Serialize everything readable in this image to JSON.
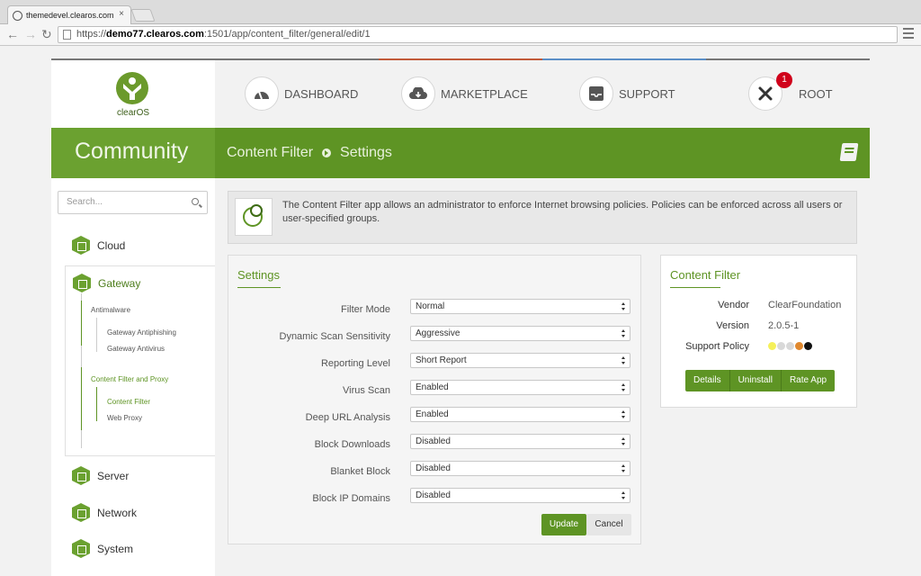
{
  "browser": {
    "tab_title": "themedevel.clearos.com",
    "tab_close": "×",
    "url_scheme": "https://",
    "url_host": "demo77.clearos.com",
    "url_rest": ":1501/app/content_filter/general/edit/1"
  },
  "header": {
    "logo_text": "clearOS",
    "nav": [
      {
        "label": "DASHBOARD",
        "icon": "gauge-icon"
      },
      {
        "label": "MARKETPLACE",
        "icon": "cloud-download-icon"
      },
      {
        "label": "SUPPORT",
        "icon": "inbox-icon"
      },
      {
        "label": "ROOT",
        "icon": "tools-icon",
        "badge": "1"
      }
    ]
  },
  "banner": {
    "edition": "Community",
    "breadcrumb_app": "Content Filter",
    "breadcrumb_page": "Settings"
  },
  "sidebar": {
    "search_placeholder": "Search...",
    "categories": {
      "cloud": "Cloud",
      "gateway": "Gateway",
      "server": "Server",
      "network": "Network",
      "system": "System"
    },
    "gateway_groups": {
      "antimalware": "Antimalware",
      "antimalware_items": [
        "Gateway Antiphishing",
        "Gateway Antivirus"
      ],
      "content_filter_proxy": "Content Filter and Proxy",
      "content_filter_items": [
        "Content Filter",
        "Web Proxy"
      ]
    }
  },
  "info": {
    "text": "The Content Filter app allows an administrator to enforce Internet browsing policies. Policies can be enforced across all users or user-specified groups."
  },
  "settings": {
    "title": "Settings",
    "rows": [
      {
        "label": "Filter Mode",
        "value": "Normal"
      },
      {
        "label": "Dynamic Scan Sensitivity",
        "value": "Aggressive"
      },
      {
        "label": "Reporting Level",
        "value": "Short Report"
      },
      {
        "label": "Virus Scan",
        "value": "Enabled"
      },
      {
        "label": "Deep URL Analysis",
        "value": "Enabled"
      },
      {
        "label": "Block Downloads",
        "value": "Disabled"
      },
      {
        "label": "Blanket Block",
        "value": "Disabled"
      },
      {
        "label": "Block IP Domains",
        "value": "Disabled"
      }
    ],
    "update_label": "Update",
    "cancel_label": "Cancel"
  },
  "app_info": {
    "title": "Content Filter",
    "vendor_label": "Vendor",
    "vendor_value": "ClearFoundation",
    "version_label": "Version",
    "version_value": "2.0.5-1",
    "support_label": "Support Policy",
    "support_dot_colors": [
      "#f5f05a",
      "#d9d9d9",
      "#d9d9d9",
      "#e0882e",
      "#111111"
    ],
    "details_label": "Details",
    "uninstall_label": "Uninstall",
    "rate_label": "Rate App"
  },
  "colors": {
    "brand_green": "#5e9424",
    "badge_red": "#d0021b"
  }
}
